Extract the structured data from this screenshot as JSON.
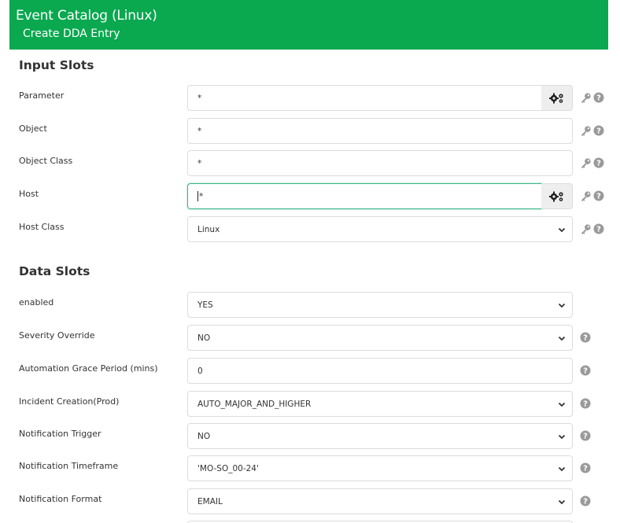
{
  "header": {
    "title": "Event Catalog (Linux)",
    "subtitle": "Create DDA Entry",
    "bg_color": "#0aa84f"
  },
  "input_slots": {
    "title": "Input Slots",
    "fields": [
      {
        "label": "Parameter",
        "value": "*",
        "type": "text"
      },
      {
        "label": "Object",
        "value": "*",
        "type": "text"
      },
      {
        "label": "Object Class",
        "value": "*",
        "type": "text"
      },
      {
        "label": "Host",
        "value": "*",
        "type": "text"
      },
      {
        "label": "Host Class",
        "value": "Linux",
        "type": "select"
      }
    ]
  },
  "data_slots": {
    "title": "Data Slots",
    "fields": [
      {
        "label": "enabled",
        "value": "YES",
        "type": "select"
      },
      {
        "label": "Severity Override",
        "value": "NO",
        "type": "select"
      },
      {
        "label": "Automation Grace Period (mins)",
        "value": "0",
        "type": "text"
      },
      {
        "label": "Incident Creation(Prod)",
        "value": "AUTO_MAJOR_AND_HIGHER",
        "type": "select"
      },
      {
        "label": "Notification Trigger",
        "value": "NO",
        "type": "select"
      },
      {
        "label": "Notification Timeframe",
        "value": "'MO-SO_00-24'",
        "type": "select"
      },
      {
        "label": "Notification Format",
        "value": "EMAIL",
        "type": "select"
      }
    ]
  },
  "icons": {
    "gear": "gears-icon",
    "key": "key-icon",
    "help": "question-circle-icon",
    "caret": "chevron-down-icon"
  }
}
